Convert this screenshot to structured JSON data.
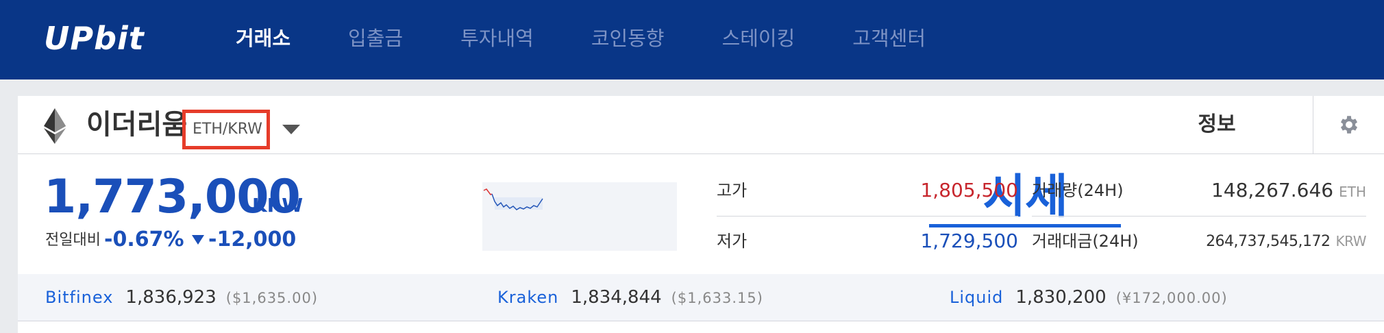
{
  "nav": {
    "logo": "UPbit",
    "items": [
      "거래소",
      "입출금",
      "투자내역",
      "코인동향",
      "스테이킹",
      "고객센터"
    ]
  },
  "coin": {
    "name": "이더리움",
    "pair": "ETH/KRW",
    "icon": "ethereum-icon"
  },
  "tabs": {
    "price": "시세",
    "info": "정보"
  },
  "ticker": {
    "price": "1,773,000",
    "unit": "KRW",
    "change_label": "전일대비",
    "change_pct": "-0.67%",
    "change_amt": "-12,000"
  },
  "stats": {
    "high_label": "고가",
    "high": "1,805,500",
    "low_label": "저가",
    "low": "1,729,500",
    "volume_label": "거래량(24H)",
    "volume": "148,267.646",
    "volume_unit": "ETH",
    "amount_label": "거래대금(24H)",
    "amount": "264,737,545,172",
    "amount_unit": "KRW"
  },
  "exchanges": [
    {
      "name": "Bitfinex",
      "price": "1,836,923",
      "sub": "($1,635.00)"
    },
    {
      "name": "Kraken",
      "price": "1,834,844",
      "sub": "($1,633.15)"
    },
    {
      "name": "Liquid",
      "price": "1,830,200",
      "sub": "(¥172,000.00)"
    }
  ],
  "colors": {
    "nav_bg": "#093687",
    "accent_blue": "#1961d9",
    "price_blue": "#1a4fb9",
    "red": "#c7262d",
    "highlight_box": "#e63c2a"
  }
}
